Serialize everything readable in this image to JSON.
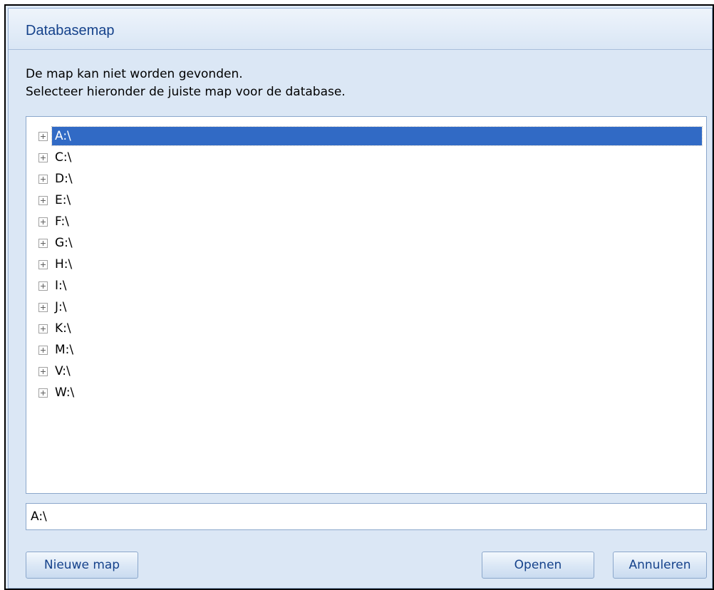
{
  "window": {
    "title": "Databasemap"
  },
  "message": {
    "line1": "De map  kan niet worden gevonden.",
    "line2": "Selecteer hieronder de juiste map voor de database."
  },
  "tree": {
    "items": [
      "A:\\",
      "C:\\",
      "D:\\",
      "E:\\",
      "F:\\",
      "G:\\",
      "H:\\",
      "I:\\",
      "J:\\",
      "K:\\",
      "M:\\",
      "V:\\",
      "W:\\"
    ],
    "selected_index": 0,
    "expander_icon": "plus-box-icon"
  },
  "path_field": {
    "value": "A:\\"
  },
  "buttons": {
    "new_folder": "Nieuwe map",
    "open": "Openen",
    "cancel": "Annuleren"
  },
  "colors": {
    "title": "#15428b",
    "selection": "#316ac5",
    "dialog_background": "#dbe7f5"
  }
}
